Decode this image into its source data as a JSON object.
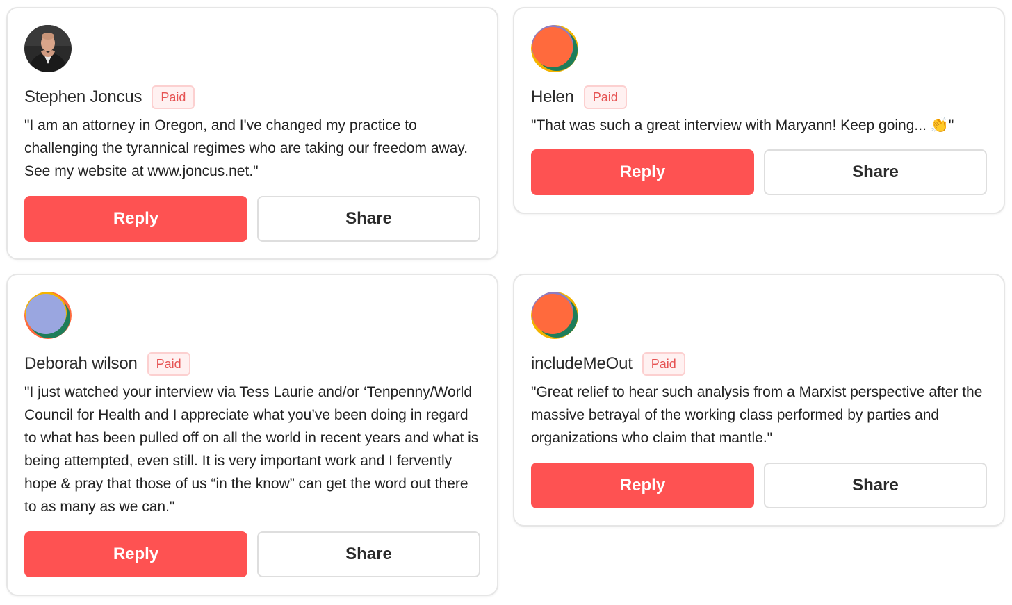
{
  "colors": {
    "accent": "#fe5252",
    "badge_text": "#e65353",
    "badge_bg": "#fff1f1",
    "card_border": "#e6e6e6"
  },
  "comments": [
    {
      "author": "Stephen Joncus",
      "badge": "Paid",
      "avatar": "photo-avatar",
      "text": "\"I am an attorney in Oregon, and I've changed my practice to challenging the tyrannical regimes who are taking our freedom away. See my website at www.joncus.net.\"",
      "reply_label": "Reply",
      "share_label": "Share"
    },
    {
      "author": "Helen",
      "badge": "Paid",
      "avatar": "default-avatar-orange",
      "text": "\"That was such a great interview with Maryann! Keep going... 👏\"",
      "reply_label": "Reply",
      "share_label": "Share"
    },
    {
      "author": "Deborah wilson",
      "badge": "Paid",
      "avatar": "default-avatar-purple",
      "text": "\"I just watched your interview via Tess Laurie and/or ‘Tenpenny/World Council for Health and I appreciate what you’ve been doing in regard to what has been pulled off on all the world in recent years and what is being attempted, even still. It is very important work and I fervently hope & pray that those of us “in the know” can get the word out there to as many as we can.\"",
      "reply_label": "Reply",
      "share_label": "Share"
    },
    {
      "author": "includeMeOut",
      "badge": "Paid",
      "avatar": "default-avatar-orange",
      "text": "\"Great relief to hear such analysis from a Marxist perspective after the massive betrayal of the working class performed by parties and organizations who claim that mantle.\"",
      "reply_label": "Reply",
      "share_label": "Share"
    }
  ]
}
